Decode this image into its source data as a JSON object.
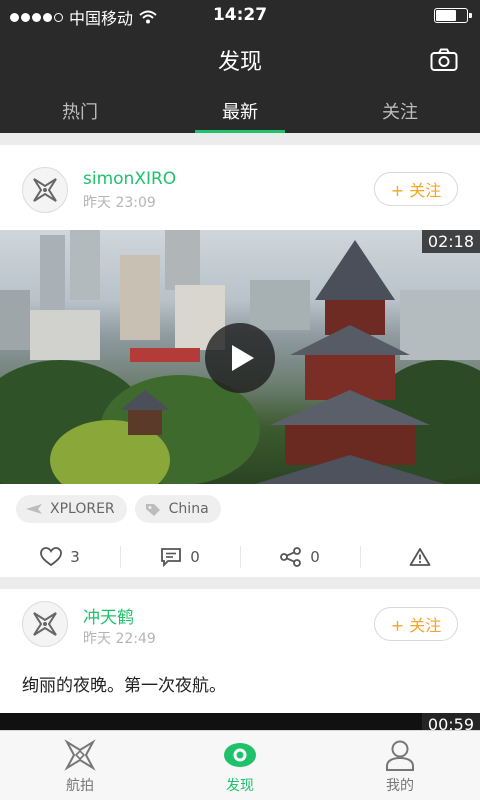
{
  "status_bar": {
    "carrier": "中国移动",
    "time": "14:27",
    "signal_filled": 4,
    "battery_level": 0.7
  },
  "header": {
    "title": "发现",
    "tabs": [
      {
        "label": "热门",
        "active": false
      },
      {
        "label": "最新",
        "active": true
      },
      {
        "label": "关注",
        "active": false
      }
    ]
  },
  "feed": [
    {
      "username": "simonXIRO",
      "time": "昨天 23:09",
      "follow_label": "+ 关注",
      "video_duration": "02:18",
      "tags": [
        {
          "icon": "drone-icon",
          "label": "XPLORER"
        },
        {
          "icon": "location-tag-icon",
          "label": "China"
        }
      ],
      "likes": "3",
      "comments": "0",
      "shares": "0"
    },
    {
      "username": "冲天鹤",
      "time": "昨天 22:49",
      "follow_label": "+ 关注",
      "text": "绚丽的夜晚。第一次夜航。",
      "video_duration": "00:59"
    }
  ],
  "bottom_nav": [
    {
      "label": "航拍",
      "icon": "drone-icon",
      "active": false
    },
    {
      "label": "发现",
      "icon": "eye-icon",
      "active": true
    },
    {
      "label": "我的",
      "icon": "user-icon",
      "active": false
    }
  ],
  "colors": {
    "accent": "#1fc26b",
    "follow": "#f5a623",
    "header_bg": "#2a2a2a"
  }
}
